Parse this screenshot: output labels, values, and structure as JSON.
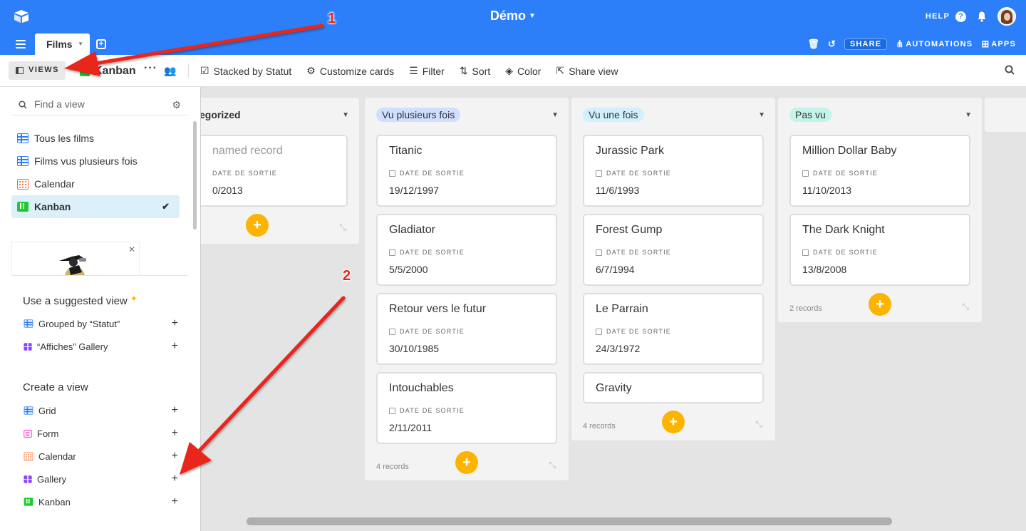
{
  "base_title": "Démo",
  "top_right": {
    "help": "HELP"
  },
  "table_tab": {
    "label": "Films"
  },
  "tab_actions": {
    "share": "SHARE",
    "automations": "AUTOMATIONS",
    "apps": "APPS"
  },
  "viewbar": {
    "views_label": "VIEWS",
    "current_view": "Kanban",
    "tools": {
      "stacked": "Stacked by Statut",
      "customize": "Customize cards",
      "filter": "Filter",
      "sort": "Sort",
      "color": "Color",
      "share_view": "Share view"
    }
  },
  "sidebar": {
    "find_placeholder": "Find a view",
    "views": [
      {
        "label": "Tous les films",
        "icon": "grid-icon"
      },
      {
        "label": "Films vus plusieurs fois",
        "icon": "grid-icon"
      },
      {
        "label": "Calendar",
        "icon": "calendar-icon"
      },
      {
        "label": "Kanban",
        "icon": "kanban-icon",
        "active": true
      }
    ],
    "suggested_title": "Use a suggested view",
    "suggested": [
      {
        "label": "Grouped by “Statut”",
        "icon": "grid-icon"
      },
      {
        "label": "“Affiches” Gallery",
        "icon": "gallery-icon"
      }
    ],
    "create_title": "Create a view",
    "create": [
      {
        "label": "Grid",
        "icon": "grid-icon"
      },
      {
        "label": "Form",
        "icon": "form-icon"
      },
      {
        "label": "Calendar",
        "icon": "calendar-icon"
      },
      {
        "label": "Gallery",
        "icon": "gallery-icon"
      },
      {
        "label": "Kanban",
        "icon": "kanban-icon"
      }
    ]
  },
  "field_label": "DATE DE SORTIE",
  "columns": [
    {
      "title": "egorized",
      "cards": [
        {
          "title": "named record",
          "date": "0/2013"
        }
      ]
    },
    {
      "title": "Vu plusieurs fois",
      "color": "#cfdfff",
      "count": "4 records",
      "cards": [
        {
          "title": "Titanic",
          "date": "19/12/1997"
        },
        {
          "title": "Gladiator",
          "date": "5/5/2000"
        },
        {
          "title": "Retour vers le futur",
          "date": "30/10/1985"
        },
        {
          "title": "Intouchables",
          "date": "2/11/2011"
        }
      ]
    },
    {
      "title": "Vu une fois",
      "color": "#d0f0fd",
      "count": "4 records",
      "cards": [
        {
          "title": "Jurassic Park",
          "date": "11/6/1993"
        },
        {
          "title": "Forest Gump",
          "date": "6/7/1994"
        },
        {
          "title": "Le Parrain",
          "date": "24/3/1972"
        },
        {
          "title": "Gravity"
        }
      ]
    },
    {
      "title": "Pas vu",
      "color": "#c2f5e9",
      "count": "2 records",
      "cards": [
        {
          "title": "Million Dollar Baby",
          "date": "11/10/2013"
        },
        {
          "title": "The Dark Knight",
          "date": "13/8/2008"
        }
      ]
    }
  ],
  "annotations": {
    "one": "1",
    "two": "2"
  },
  "colors": {
    "brand_blue": "#2d7ff9",
    "add_button": "#fcb400",
    "arrow": "#e8261c"
  }
}
